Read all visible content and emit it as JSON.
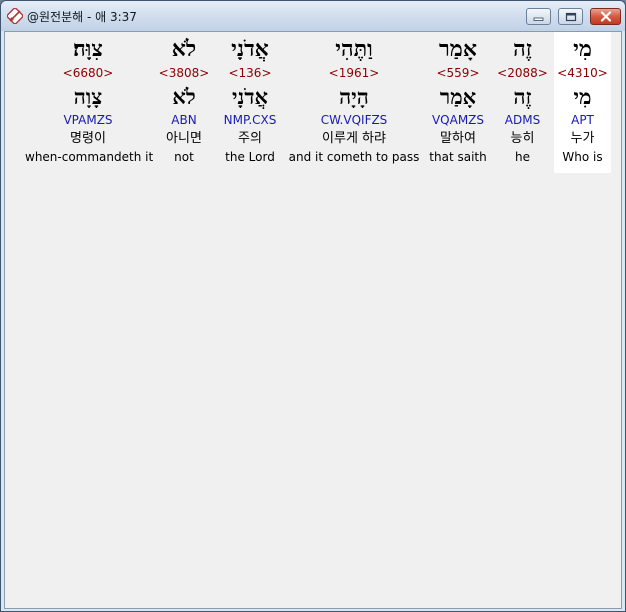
{
  "window": {
    "title": "@원전분해 - 애 3:37",
    "icon": "app-tools-icon"
  },
  "words": [
    {
      "hebrew_form": "מִי",
      "strong": "<4310>",
      "lemma": "מִי",
      "morph": "APT",
      "korean": "누가",
      "english": "Who is",
      "highlighted": true
    },
    {
      "hebrew_form": "זֶה",
      "strong": "<2088>",
      "lemma": "זֶה",
      "morph": "ADMS",
      "korean": "능히",
      "english": "he",
      "highlighted": false
    },
    {
      "hebrew_form": "אָמַר",
      "strong": "<559>",
      "lemma": "אָמַר",
      "morph": "VQAMZS",
      "korean": "말하여",
      "english": "that saith",
      "highlighted": false
    },
    {
      "hebrew_form": "וַתֶּהִי",
      "strong": "<1961>",
      "lemma": "הָיָה",
      "morph": "CW.VQIFZS",
      "korean": "이루게 하랴",
      "english": "and it cometh to pass",
      "highlighted": false
    },
    {
      "hebrew_form": "אֲדֹנָי",
      "strong": "<136>",
      "lemma": "אֲדֹנָי",
      "morph": "NMP.CXS",
      "korean": "주의",
      "english": "the Lord",
      "highlighted": false
    },
    {
      "hebrew_form": "לֹא",
      "strong": "<3808>",
      "lemma": "לֹא",
      "morph": "ABN",
      "korean": "아니면",
      "english": "not",
      "highlighted": false
    },
    {
      "hebrew_form": "צִוָּה׃",
      "strong": "<6680>",
      "lemma": "צָוָה",
      "morph": "VPAMZS",
      "korean": "명령이",
      "english": "when-commandeth it",
      "highlighted": false
    }
  ]
}
